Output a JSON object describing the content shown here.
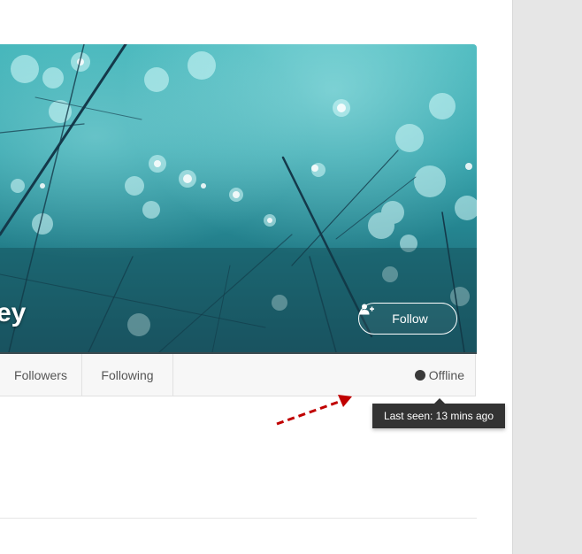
{
  "profile": {
    "name": "ey",
    "follow_label": "Follow"
  },
  "tabs": [
    {
      "label": "Followers"
    },
    {
      "label": "Following"
    }
  ],
  "status": {
    "label": "Offline",
    "tooltip": "Last seen: 13 mins ago"
  },
  "colors": {
    "cover_teal": "#2c9fa8",
    "status_dot": "#3a3a3a",
    "annotation_arrow": "#c00000",
    "tooltip_bg": "#333333"
  },
  "icons": {
    "follow": "user-plus-icon",
    "status": "status-dot-icon",
    "annotation": "dashed-arrow-icon"
  }
}
